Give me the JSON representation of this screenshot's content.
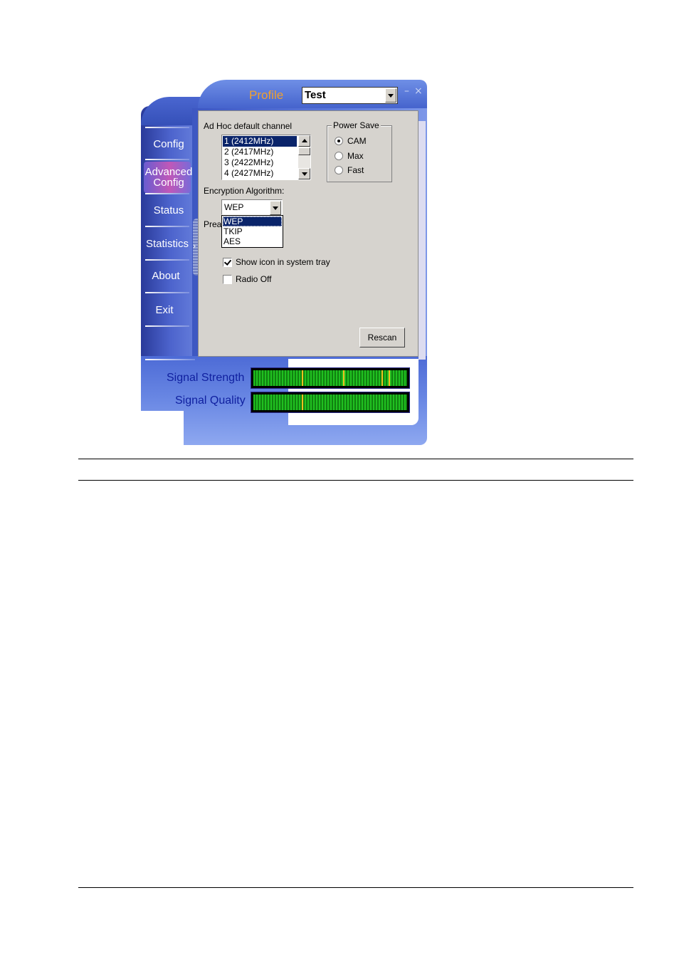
{
  "header": {
    "profile_label": "Profile",
    "profile_value": "Test",
    "minimize_glyph": "–",
    "close_glyph": "×"
  },
  "sidebar": {
    "items": [
      {
        "label": "Config"
      },
      {
        "label": "Advanced\nConfig",
        "active": true
      },
      {
        "label": "Status"
      },
      {
        "label": "Statistics"
      },
      {
        "label": "About"
      },
      {
        "label": "Exit"
      }
    ]
  },
  "panel": {
    "adhoc_label": "Ad Hoc default channel",
    "channels": [
      "1  (2412MHz)",
      "2  (2417MHz)",
      "3  (2422MHz)",
      "4  (2427MHz)"
    ],
    "selected_channel": "1  (2412MHz)",
    "power_save": {
      "title": "Power Save",
      "options": [
        "CAM",
        "Max",
        "Fast"
      ],
      "selected": "CAM"
    },
    "encryption_label": "Encryption Algorithm:",
    "encryption_value": "WEP",
    "encryption_options": [
      "WEP",
      "TKIP",
      "AES"
    ],
    "preamble_label_partial": "Prea",
    "show_icon_label": "Show icon in system tray",
    "show_icon_checked": true,
    "radio_off_label": "Radio Off",
    "radio_off_checked": false,
    "rescan_label": "Rescan"
  },
  "signal": {
    "strength_label": "Signal Strength",
    "quality_label": "Signal Quality"
  },
  "colors": {
    "frame_blue": "#4c63cc",
    "profile_orange": "#f0a030",
    "selection_blue": "#0a246a",
    "meter_green": "#20c020",
    "signal_label": "#1020a0"
  }
}
